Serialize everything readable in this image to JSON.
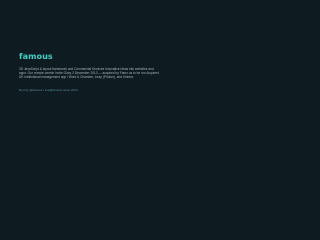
{
  "brand": {
    "name": "famous",
    "accent_color": "#3fd2c7",
    "background_color": "#0e1c22"
  },
  "about": {
    "description": "3D JavaScript & layout framework and Commercial Services Innovative ideas into websites and apps. Our remote-centric Invite Glory 3 December 2013 — acquired by Famo.us to be run Acquired UK Institutional management app / Work & Chamber, Leap (Photon), and Kintera."
  },
  "footer": {
    "link_text": "Run by @famous / sec@famous since 2013"
  }
}
